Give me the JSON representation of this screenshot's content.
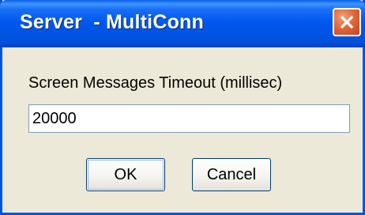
{
  "window": {
    "title": "Server  - MultiConn"
  },
  "form": {
    "label": "Screen Messages Timeout (millisec)",
    "timeout_value": "20000"
  },
  "buttons": {
    "ok_label": "OK",
    "cancel_label": "Cancel"
  },
  "icons": {
    "close": "close-icon"
  },
  "colors": {
    "titlebar": "#0054e3",
    "close_button": "#e06a3c",
    "dialog_background": "#ece9d8"
  }
}
